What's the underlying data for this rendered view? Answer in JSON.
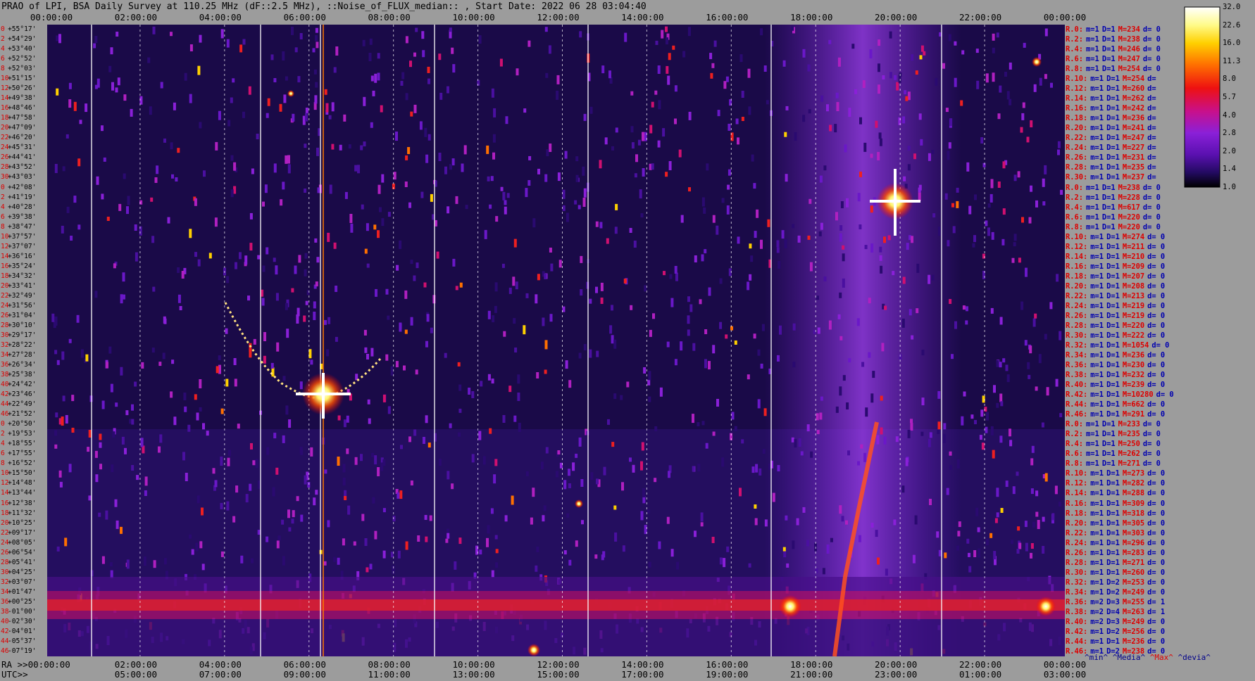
{
  "title": "PRAO of LPI, BSA Daily Survey at 110.25 MHz (dF::2.5 MHz), ::Noise_of_FLUX_median:: , Start Date: 2022 06 28 03:04:40",
  "top_axis": {
    "ticks": [
      "00:00:00",
      "02:00:00",
      "04:00:00",
      "06:00:00",
      "08:00:00",
      "10:00:00",
      "12:00:00",
      "14:00:00",
      "16:00:00",
      "18:00:00",
      "20:00:00",
      "22:00:00",
      "00:00:00"
    ]
  },
  "bottom_axis": {
    "ra_prefix": "RA >>00:00:00",
    "utc_prefix": "UTC>>",
    "ra_ticks": [
      "02:00:00",
      "04:00:00",
      "06:00:00",
      "08:00:00",
      "10:00:00",
      "12:00:00",
      "14:00:00",
      "16:00:00",
      "18:00:00",
      "20:00:00",
      "22:00:00",
      "00:00:00"
    ],
    "utc_ticks": [
      "05:00:00",
      "07:00:00",
      "09:00:00",
      "11:00:00",
      "13:00:00",
      "15:00:00",
      "17:00:00",
      "19:00:00",
      "21:00:00",
      "23:00:00",
      "01:00:00",
      "03:00:00"
    ]
  },
  "declinations": [
    "+55°17'",
    "+54°29'",
    "+53°40'",
    "+52°52'",
    "+52°03'",
    "+51°15'",
    "+50°26'",
    "+49°38'",
    "+48°46'",
    "+47°58'",
    "+47°09'",
    "+46°20'",
    "+45°31'",
    "+44°41'",
    "+43°52'",
    "+43°03'",
    "+42°08'",
    "+41°19'",
    "+40°28'",
    "+39°38'",
    "+38°47'",
    "+37°57'",
    "+37°07'",
    "+36°16'",
    "+35°24'",
    "+34°32'",
    "+33°41'",
    "+32°49'",
    "+31°56'",
    "+31°04'",
    "+30°10'",
    "+29°17'",
    "+28°22'",
    "+27°28'",
    "+26°34'",
    "+25°38'",
    "+24°42'",
    "+23°46'",
    "+22°49'",
    "+21°52'",
    "+20°50'",
    "+19°53'",
    "+18°55'",
    "+17°55'",
    "+16°52'",
    "+15°50'",
    "+14°48'",
    "+13°44'",
    "+12°38'",
    "+11°32'",
    "+10°25'",
    "+09°17'",
    "+08°05'",
    "+06°54'",
    "+05°41'",
    "+04°25'",
    "+03°07'",
    "+01°47'",
    "+00°25'",
    "-01°00'",
    "-02°30'",
    "-04°01'",
    "-05°37'",
    "-07°19'"
  ],
  "row_indices": [
    "0",
    "2",
    "4",
    "6",
    "8",
    "10",
    "12",
    "14",
    "16",
    "18",
    "20",
    "22",
    "24",
    "26",
    "28",
    "30",
    "0",
    "2",
    "4",
    "6",
    "8",
    "10",
    "12",
    "14",
    "16",
    "18",
    "20",
    "22",
    "24",
    "26",
    "28",
    "30",
    "32",
    "34",
    "36",
    "38",
    "40",
    "42",
    "44",
    "46",
    "0",
    "2",
    "4",
    "6",
    "8",
    "10",
    "12",
    "14",
    "16",
    "18",
    "20",
    "22",
    "24",
    "26",
    "28",
    "30",
    "32",
    "34",
    "36",
    "38",
    "40",
    "42",
    "44",
    "46"
  ],
  "stats": [
    {
      "r": "R.0:",
      "m": "m=1",
      "d": "D=1",
      "mx": "M=234",
      "dv": "d= 0"
    },
    {
      "r": "R.2:",
      "m": "m=1",
      "d": "D=1",
      "mx": "M=238",
      "dv": "d= 0"
    },
    {
      "r": "R.4:",
      "m": "m=1",
      "d": "D=1",
      "mx": "M=246",
      "dv": "d= 0"
    },
    {
      "r": "R.6:",
      "m": "m=1",
      "d": "D=1",
      "mx": "M=247",
      "dv": "d= 0"
    },
    {
      "r": "R.8:",
      "m": "m=1",
      "d": "D=1",
      "mx": "M=254",
      "dv": "d= 0"
    },
    {
      "r": "R.10:",
      "m": "m=1",
      "d": "D=1",
      "mx": "M=254",
      "dv": "d="
    },
    {
      "r": "R.12:",
      "m": "m=1",
      "d": "D=1",
      "mx": "M=260",
      "dv": "d="
    },
    {
      "r": "R.14:",
      "m": "m=1",
      "d": "D=1",
      "mx": "M=262",
      "dv": "d="
    },
    {
      "r": "R.16:",
      "m": "m=1",
      "d": "D=1",
      "mx": "M=242",
      "dv": "d="
    },
    {
      "r": "R.18:",
      "m": "m=1",
      "d": "D=1",
      "mx": "M=236",
      "dv": "d="
    },
    {
      "r": "R.20:",
      "m": "m=1",
      "d": "D=1",
      "mx": "M=241",
      "dv": "d="
    },
    {
      "r": "R.22:",
      "m": "m=1",
      "d": "D=1",
      "mx": "M=247",
      "dv": "d="
    },
    {
      "r": "R.24:",
      "m": "m=1",
      "d": "D=1",
      "mx": "M=227",
      "dv": "d="
    },
    {
      "r": "R.26:",
      "m": "m=1",
      "d": "D=1",
      "mx": "M=231",
      "dv": "d="
    },
    {
      "r": "R.28:",
      "m": "m=1",
      "d": "D=1",
      "mx": "M=235",
      "dv": "d="
    },
    {
      "r": "R.30:",
      "m": "m=1",
      "d": "D=1",
      "mx": "M=237",
      "dv": "d="
    },
    {
      "r": "R.0:",
      "m": "m=1",
      "d": "D=1",
      "mx": "M=238",
      "dv": "d= 0"
    },
    {
      "r": "R.2:",
      "m": "m=1",
      "d": "D=1",
      "mx": "M=228",
      "dv": "d= 0"
    },
    {
      "r": "R.4:",
      "m": "m=1",
      "d": "D=1",
      "mx": "M=617",
      "dv": "d= 0"
    },
    {
      "r": "R.6:",
      "m": "m=1",
      "d": "D=1",
      "mx": "M=220",
      "dv": "d= 0"
    },
    {
      "r": "R.8:",
      "m": "m=1",
      "d": "D=1",
      "mx": "M=220",
      "dv": "d= 0"
    },
    {
      "r": "R.10:",
      "m": "m=1",
      "d": "D=1",
      "mx": "M=274",
      "dv": "d= 0"
    },
    {
      "r": "R.12:",
      "m": "m=1",
      "d": "D=1",
      "mx": "M=211",
      "dv": "d= 0"
    },
    {
      "r": "R.14:",
      "m": "m=1",
      "d": "D=1",
      "mx": "M=210",
      "dv": "d= 0"
    },
    {
      "r": "R.16:",
      "m": "m=1",
      "d": "D=1",
      "mx": "M=209",
      "dv": "d= 0"
    },
    {
      "r": "R.18:",
      "m": "m=1",
      "d": "D=1",
      "mx": "M=207",
      "dv": "d= 0"
    },
    {
      "r": "R.20:",
      "m": "m=1",
      "d": "D=1",
      "mx": "M=208",
      "dv": "d= 0"
    },
    {
      "r": "R.22:",
      "m": "m=1",
      "d": "D=1",
      "mx": "M=213",
      "dv": "d= 0"
    },
    {
      "r": "R.24:",
      "m": "m=1",
      "d": "D=1",
      "mx": "M=219",
      "dv": "d= 0"
    },
    {
      "r": "R.26:",
      "m": "m=1",
      "d": "D=1",
      "mx": "M=219",
      "dv": "d= 0"
    },
    {
      "r": "R.28:",
      "m": "m=1",
      "d": "D=1",
      "mx": "M=220",
      "dv": "d= 0"
    },
    {
      "r": "R.30:",
      "m": "m=1",
      "d": "D=1",
      "mx": "M=222",
      "dv": "d= 0"
    },
    {
      "r": "R.32:",
      "m": "m=1",
      "d": "D=1",
      "mx": "M=1054",
      "dv": "d= 0"
    },
    {
      "r": "R.34:",
      "m": "m=1",
      "d": "D=1",
      "mx": "M=236",
      "dv": "d= 0"
    },
    {
      "r": "R.36:",
      "m": "m=1",
      "d": "D=1",
      "mx": "M=230",
      "dv": "d= 0"
    },
    {
      "r": "R.38:",
      "m": "m=1",
      "d": "D=1",
      "mx": "M=232",
      "dv": "d= 0"
    },
    {
      "r": "R.40:",
      "m": "m=1",
      "d": "D=1",
      "mx": "M=239",
      "dv": "d= 0"
    },
    {
      "r": "R.42:",
      "m": "m=1",
      "d": "D=1",
      "mx": "M=10280",
      "dv": "d= 0"
    },
    {
      "r": "R.44:",
      "m": "m=1",
      "d": "D=1",
      "mx": "M=662",
      "dv": "d= 0"
    },
    {
      "r": "R.46:",
      "m": "m=1",
      "d": "D=1",
      "mx": "M=291",
      "dv": "d= 0"
    },
    {
      "r": "R.0:",
      "m": "m=1",
      "d": "D=1",
      "mx": "M=233",
      "dv": "d= 0"
    },
    {
      "r": "R.2:",
      "m": "m=1",
      "d": "D=1",
      "mx": "M=235",
      "dv": "d= 0"
    },
    {
      "r": "R.4:",
      "m": "m=1",
      "d": "D=1",
      "mx": "M=250",
      "dv": "d= 0"
    },
    {
      "r": "R.6:",
      "m": "m=1",
      "d": "D=1",
      "mx": "M=262",
      "dv": "d= 0"
    },
    {
      "r": "R.8:",
      "m": "m=1",
      "d": "D=1",
      "mx": "M=271",
      "dv": "d= 0"
    },
    {
      "r": "R.10:",
      "m": "m=1",
      "d": "D=1",
      "mx": "M=273",
      "dv": "d= 0"
    },
    {
      "r": "R.12:",
      "m": "m=1",
      "d": "D=1",
      "mx": "M=282",
      "dv": "d= 0"
    },
    {
      "r": "R.14:",
      "m": "m=1",
      "d": "D=1",
      "mx": "M=288",
      "dv": "d= 0"
    },
    {
      "r": "R.16:",
      "m": "m=1",
      "d": "D=1",
      "mx": "M=309",
      "dv": "d= 0"
    },
    {
      "r": "R.18:",
      "m": "m=1",
      "d": "D=1",
      "mx": "M=318",
      "dv": "d= 0"
    },
    {
      "r": "R.20:",
      "m": "m=1",
      "d": "D=1",
      "mx": "M=305",
      "dv": "d= 0"
    },
    {
      "r": "R.22:",
      "m": "m=1",
      "d": "D=1",
      "mx": "M=303",
      "dv": "d= 0"
    },
    {
      "r": "R.24:",
      "m": "m=1",
      "d": "D=1",
      "mx": "M=296",
      "dv": "d= 0"
    },
    {
      "r": "R.26:",
      "m": "m=1",
      "d": "D=1",
      "mx": "M=283",
      "dv": "d= 0"
    },
    {
      "r": "R.28:",
      "m": "m=1",
      "d": "D=1",
      "mx": "M=271",
      "dv": "d= 0"
    },
    {
      "r": "R.30:",
      "m": "m=1",
      "d": "D=1",
      "mx": "M=260",
      "dv": "d= 0"
    },
    {
      "r": "R.32:",
      "m": "m=1",
      "d": "D=2",
      "mx": "M=253",
      "dv": "d= 0"
    },
    {
      "r": "R.34:",
      "m": "m=1",
      "d": "D=2",
      "mx": "M=249",
      "dv": "d= 0"
    },
    {
      "r": "R.36:",
      "m": "m=2",
      "d": "D=3",
      "mx": "M=255",
      "dv": "d= 1"
    },
    {
      "r": "R.38:",
      "m": "m=2",
      "d": "D=4",
      "mx": "M=263",
      "dv": "d= 1"
    },
    {
      "r": "R.40:",
      "m": "m=2",
      "d": "D=3",
      "mx": "M=249",
      "dv": "d= 0"
    },
    {
      "r": "R.42:",
      "m": "m=1",
      "d": "D=2",
      "mx": "M=256",
      "dv": "d= 0"
    },
    {
      "r": "R.44:",
      "m": "m=1",
      "d": "D=1",
      "mx": "M=236",
      "dv": "d= 0"
    },
    {
      "r": "R.46:",
      "m": "m=1",
      "d": "D=2",
      "mx": "M=238",
      "dv": "d= 0"
    }
  ],
  "legend": {
    "min": "^min^",
    "median": "^Media^",
    "max": "^Max^",
    "dev": "^devia^"
  },
  "colorbar": {
    "labels": [
      "32.0",
      "22.6",
      "16.0",
      "11.3",
      "8.0",
      "5.7",
      "4.0",
      "2.8",
      "2.0",
      "1.4",
      "1.0"
    ]
  },
  "chart_data": {
    "type": "heatmap",
    "title": "PRAO of LPI, BSA Daily Survey at 110.25 MHz (dF::2.5 MHz), ::Noise_of_FLUX_median:: , Start Date: 2022 06 28 03:04:40",
    "x_axis": "Sidereal time (RA) 00:00:00 → 00:00:00; UTC 03:00:00 → 03:00:00",
    "y_axis": "Declination +55°17' → -07°19' (64 beams)",
    "color_scale": [
      1.0,
      32.0
    ],
    "features": [
      {
        "ra": "06:28",
        "dec": "+23°46'",
        "note": "very bright point source with cross artifact"
      },
      {
        "ra": "20:00",
        "dec": "+41°19'",
        "note": "very bright point source with cross artifact"
      },
      {
        "ra": "05:30-08:00",
        "dec": "+23° to +30°",
        "note": "bright arc (solar/satellite track)"
      },
      {
        "ra": "18:00-22:00",
        "dec": "band",
        "note": "Milky Way diffuse emission stripe"
      },
      {
        "ra": "00:00-24:00",
        "dec": "+00°25' to -02°30'",
        "note": "horizontal bright interference band"
      }
    ]
  }
}
